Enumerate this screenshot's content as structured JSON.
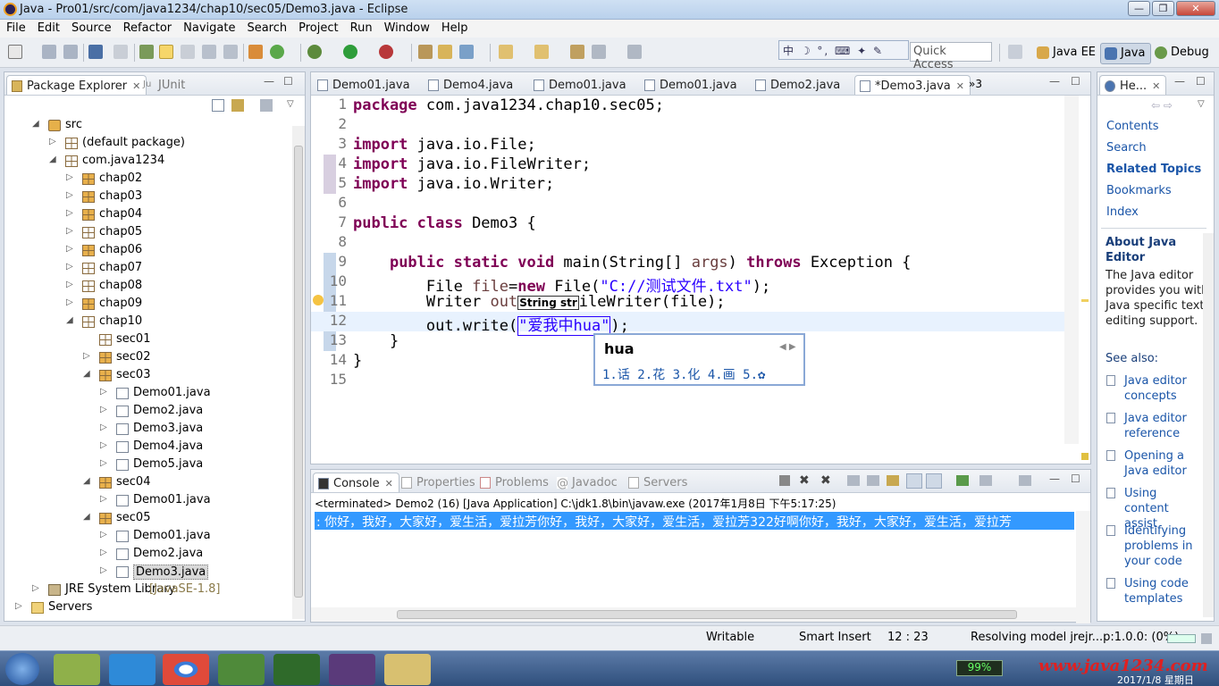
{
  "window": {
    "title": "Java - Pro01/src/com/java1234/chap10/sec05/Demo3.java - Eclipse",
    "min": "—",
    "max": "❐",
    "close": "✕"
  },
  "menu": [
    "File",
    "Edit",
    "Source",
    "Refactor",
    "Navigate",
    "Search",
    "Project",
    "Run",
    "Window",
    "Help"
  ],
  "toolbar": {
    "quick_access": "Quick Access",
    "ime_bar": "中 ☽ °, ⌨ ✦ ✎",
    "perspectives": [
      "Java EE",
      "Java",
      "Debug"
    ]
  },
  "package_explorer": {
    "tabs": [
      "Package Explorer",
      "JUnit"
    ],
    "tree": [
      {
        "label": "src",
        "level": 1,
        "arrow": "◢",
        "icon": "src"
      },
      {
        "label": "(default package)",
        "level": 2,
        "arrow": "▷",
        "icon": "pkg"
      },
      {
        "label": "com.java1234",
        "level": 2,
        "arrow": "◢",
        "icon": "pkg"
      },
      {
        "label": "chap02",
        "level": 3,
        "arrow": "▷",
        "icon": "pkg-brown"
      },
      {
        "label": "chap03",
        "level": 3,
        "arrow": "▷",
        "icon": "pkg-brown"
      },
      {
        "label": "chap04",
        "level": 3,
        "arrow": "▷",
        "icon": "pkg-brown"
      },
      {
        "label": "chap05",
        "level": 3,
        "arrow": "▷",
        "icon": "pkg"
      },
      {
        "label": "chap06",
        "level": 3,
        "arrow": "▷",
        "icon": "pkg-brown"
      },
      {
        "label": "chap07",
        "level": 3,
        "arrow": "▷",
        "icon": "pkg"
      },
      {
        "label": "chap08",
        "level": 3,
        "arrow": "▷",
        "icon": "pkg"
      },
      {
        "label": "chap09",
        "level": 3,
        "arrow": "▷",
        "icon": "pkg-brown"
      },
      {
        "label": "chap10",
        "level": 3,
        "arrow": "◢",
        "icon": "pkg"
      },
      {
        "label": "sec01",
        "level": 4,
        "arrow": "",
        "icon": "pkg"
      },
      {
        "label": "sec02",
        "level": 4,
        "arrow": "▷",
        "icon": "pkg-brown"
      },
      {
        "label": "sec03",
        "level": 4,
        "arrow": "◢",
        "icon": "pkg-brown"
      },
      {
        "label": "Demo01.java",
        "level": 5,
        "arrow": "▷",
        "icon": "java"
      },
      {
        "label": "Demo2.java",
        "level": 5,
        "arrow": "▷",
        "icon": "java"
      },
      {
        "label": "Demo3.java",
        "level": 5,
        "arrow": "▷",
        "icon": "java"
      },
      {
        "label": "Demo4.java",
        "level": 5,
        "arrow": "▷",
        "icon": "java"
      },
      {
        "label": "Demo5.java",
        "level": 5,
        "arrow": "▷",
        "icon": "java"
      },
      {
        "label": "sec04",
        "level": 4,
        "arrow": "◢",
        "icon": "pkg-brown"
      },
      {
        "label": "Demo01.java",
        "level": 5,
        "arrow": "▷",
        "icon": "java"
      },
      {
        "label": "sec05",
        "level": 4,
        "arrow": "◢",
        "icon": "pkg-brown"
      },
      {
        "label": "Demo01.java",
        "level": 5,
        "arrow": "▷",
        "icon": "java"
      },
      {
        "label": "Demo2.java",
        "level": 5,
        "arrow": "▷",
        "icon": "java"
      },
      {
        "label": "Demo3.java",
        "level": 5,
        "arrow": "▷",
        "icon": "java",
        "selected": true
      },
      {
        "label": "JRE System Library",
        "suffix": "[JavaSE-1.8]",
        "level": 1,
        "arrow": "▷",
        "icon": "lib"
      },
      {
        "label": "Servers",
        "level": 0,
        "arrow": "▷",
        "icon": "folder"
      }
    ]
  },
  "editor": {
    "tabs": [
      "Demo01.java",
      "Demo4.java",
      "Demo01.java",
      "Demo01.java",
      "Demo2.java",
      "*Demo3.java"
    ],
    "overflow": "»3",
    "lines": [
      "1",
      "2",
      "3",
      "4",
      "5",
      "6",
      "7",
      "8",
      "9",
      "10",
      "11",
      "12",
      "13",
      "14",
      "15"
    ],
    "code": {
      "l1_kw": "package",
      "l1_rest": " com.java1234.chap10.sec05;",
      "import_kw": "import",
      "l3_rest": " java.io.File;",
      "l4_rest": " java.io.FileWriter;",
      "l5_rest": " java.io.Writer;",
      "l7_kw": "public class",
      "l7_rest": " Demo3 {",
      "l9_indent": "    ",
      "l9_kw": "public static void",
      "l9_a": " main(String[] ",
      "l9_var": "args",
      "l9_b": ") ",
      "l9_kw2": "throws",
      "l9_c": " Exception {",
      "l10_a": "        File ",
      "l10_var": "file",
      "l10_b": "=",
      "l10_kw": "new",
      "l10_c": " File(",
      "l10_str": "\"C://测试文件.txt\"",
      "l10_d": ");",
      "l11_a": "        Writer ",
      "l11_var": "out",
      "l11_hint": "String str",
      "l11_b": "ileWriter(file);",
      "l12_a": "        out.write(",
      "l12_str": "\"爱我中hua\"",
      "l12_b": ");",
      "l13": "    }",
      "l14": "}"
    },
    "ime_popup": {
      "input": "hua",
      "candidates": "1.话 2.花 3.化 4.画 5.✿"
    }
  },
  "help": {
    "tab": "He...",
    "links": [
      "Contents",
      "Search",
      "Related Topics",
      "Bookmarks",
      "Index"
    ],
    "heading": "About Java Editor",
    "description": "The Java editor provides you with Java specific text editing support.",
    "see_also": "See also:",
    "see_links": [
      "Java editor concepts",
      "Java editor reference",
      "Opening a Java editor",
      "Using content assist",
      "Identifying problems in your code",
      "Using code templates"
    ]
  },
  "console": {
    "tabs": [
      "Console",
      "Properties",
      "Problems",
      "Javadoc",
      "Servers"
    ],
    "status": "<terminated> Demo2 (16) [Java Application] C:\\jdk1.8\\bin\\javaw.exe (2017年1月8日 下午5:17:25)",
    "output": ": 你好，我好，大家好，爱生活，爱拉芳你好，我好，大家好，爱生活，爱拉芳322好啊你好，我好，大家好，爱生活，爱拉芳"
  },
  "statusbar": {
    "writable": "Writable",
    "insert_mode": "Smart Insert",
    "position": "12 : 23",
    "progress": "Resolving model jrejr...p:1.0.0: (0%)"
  },
  "taskbar": {
    "battery": "99%",
    "watermark": "www.java1234.com",
    "date": "2017/1/8 星期日"
  },
  "colors": {
    "keyword": "#7f0055",
    "string": "#2a00ff",
    "link": "#1a55a8",
    "selection": "#3399ff"
  }
}
